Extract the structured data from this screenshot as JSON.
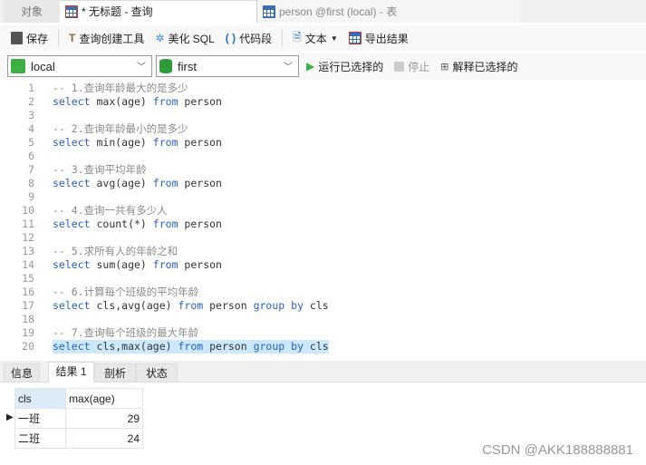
{
  "tabs": [
    {
      "label": "对象"
    },
    {
      "label": "* 无标题 - 查询",
      "icon": "query-table-icon"
    },
    {
      "label": "person @first (local) - 表",
      "icon": "table-icon"
    }
  ],
  "toolbar": {
    "save": "保存",
    "query_builder": "查询创建工具",
    "beautify": "美化 SQL",
    "snippet": "代码段",
    "text": "文本",
    "export": "导出结果"
  },
  "connection": {
    "value": "local"
  },
  "database": {
    "value": "first"
  },
  "actions": {
    "run_selected": "运行已选择的",
    "stop": "停止",
    "explain_selected": "解释已选择的"
  },
  "editor": {
    "lines": [
      "-- 1.查询年龄最大的是多少",
      "select max(age) from person",
      "",
      "-- 2.查询年龄最小的是多少",
      "select min(age) from person",
      "",
      "-- 3.查询平均年龄",
      "select avg(age) from person",
      "",
      "-- 4.查询一共有多少人",
      "select count(*) from person",
      "",
      "-- 5.求所有人的年龄之和",
      "select sum(age) from person",
      "",
      "-- 6.计算每个班级的平均年龄",
      "select cls,avg(age) from person group by cls",
      "",
      "-- 7.查询每个班级的最大年龄",
      "select cls,max(age) from person group by cls"
    ],
    "selected_line": 20
  },
  "result_tabs": [
    {
      "label": "信息"
    },
    {
      "label": "结果 1",
      "active": true
    },
    {
      "label": "剖析"
    },
    {
      "label": "状态"
    }
  ],
  "result": {
    "columns": [
      "cls",
      "max(age)"
    ],
    "rows": [
      [
        "一班",
        "29"
      ],
      [
        "二班",
        "24"
      ]
    ]
  },
  "watermark": "CSDN @AKK188888881"
}
